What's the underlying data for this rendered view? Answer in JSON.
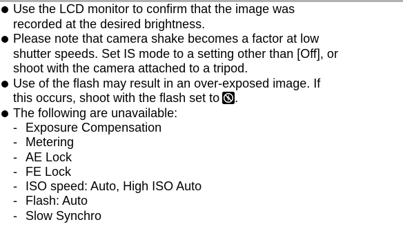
{
  "bullets": [
    {
      "lines": [
        "Use the LCD monitor to confirm that the image was",
        "recorded at the desired brightness."
      ]
    },
    {
      "lines": [
        "Please note that camera shake becomes a factor at low",
        "shutter speeds. Set IS mode to a setting other than [Off], or",
        "shoot with the camera attached to a tripod."
      ]
    },
    {
      "lines": [
        "Use of the flash may result in an over-exposed image. If",
        "this occurs, shoot with the flash set to"
      ],
      "trailing_icon": "flash-off-icon",
      "trailing_text": "."
    },
    {
      "lines": [
        "The following are unavailable:"
      ]
    }
  ],
  "unavailable_items": [
    "Exposure Compensation",
    "Metering",
    "AE Lock",
    "FE Lock",
    "ISO speed: Auto, High ISO Auto",
    "Flash: Auto",
    "Slow Synchro"
  ],
  "dash_symbol": "-",
  "colors": {
    "top_rule": "#b0b0b0",
    "text": "#000000"
  }
}
